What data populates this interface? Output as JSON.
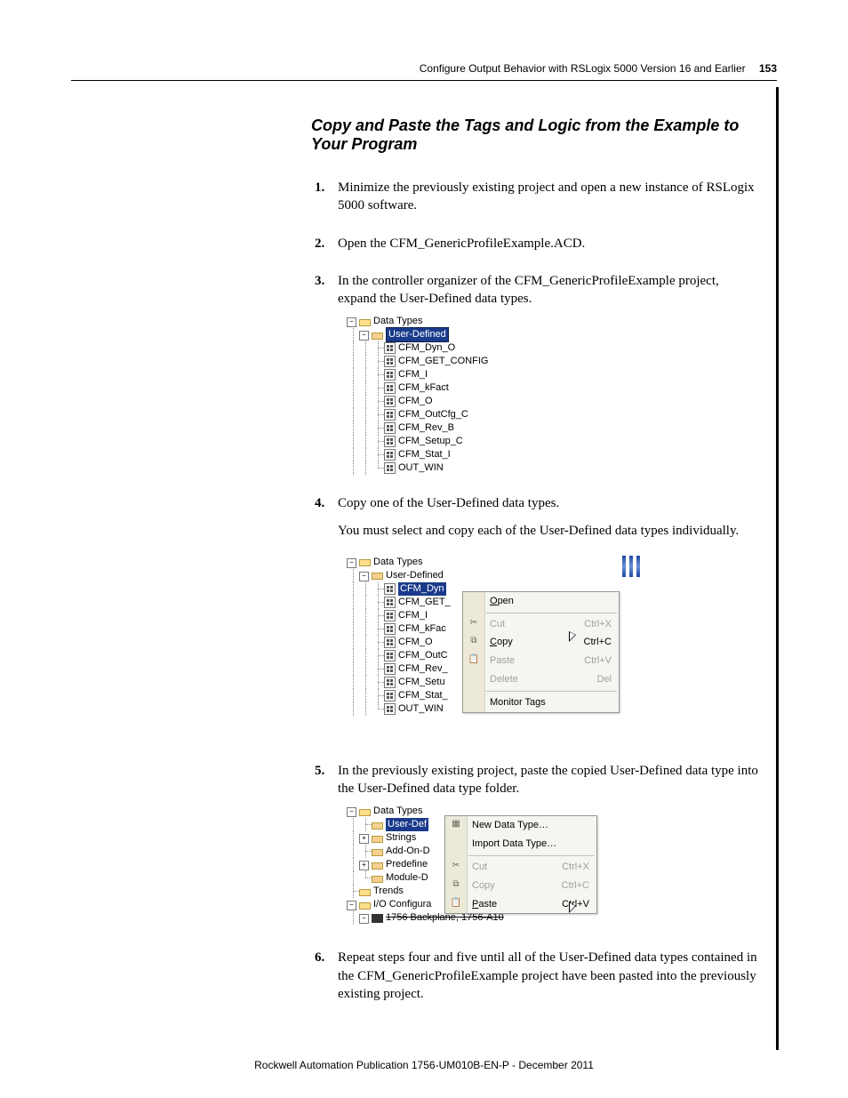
{
  "header": {
    "chapter": "Configure Output Behavior with RSLogix 5000 Version 16 and Earlier",
    "page": "153"
  },
  "section_title": "Copy and Paste the Tags and Logic from the Example to Your Program",
  "steps": {
    "s1": {
      "n": "1.",
      "t": "Minimize the previously existing project and open a new instance of RSLogix 5000 software."
    },
    "s2": {
      "n": "2.",
      "t": "Open the CFM_GenericProfileExample.ACD."
    },
    "s3": {
      "n": "3.",
      "t": "In the controller organizer of the CFM_GenericProfileExample project, expand the User-Defined data types."
    },
    "s4": {
      "n": "4.",
      "t": "Copy one of the User-Defined data types."
    },
    "s4p": "You must select and copy each of the User-Defined data types individually.",
    "s5": {
      "n": "5.",
      "t": "In the previously existing project, paste the copied User-Defined data type into the User-Defined data type folder."
    },
    "s6": {
      "n": "6.",
      "t": "Repeat steps four and five until all of the User-Defined data types contained in the CFM_GenericProfileExample project have been pasted into the previously existing project."
    }
  },
  "fig3": {
    "root": "Data Types",
    "folder": "User-Defined",
    "items": [
      "CFM_Dyn_O",
      "CFM_GET_CONFIG",
      "CFM_I",
      "CFM_kFact",
      "CFM_O",
      "CFM_OutCfg_C",
      "CFM_Rev_B",
      "CFM_Setup_C",
      "CFM_Stat_I",
      "OUT_WIN"
    ]
  },
  "fig4": {
    "root": "Data Types",
    "folder": "User-Defined",
    "sel": "CFM_Dyn",
    "rest": [
      "CFM_GET_",
      "CFM_I",
      "CFM_kFac",
      "CFM_O",
      "CFM_OutC",
      "CFM_Rev_",
      "CFM_Setu",
      "CFM_Stat_",
      "OUT_WIN"
    ],
    "menu": {
      "open": "Open",
      "cut": "Cut",
      "cut_sc": "Ctrl+X",
      "copy": "Copy",
      "copy_sc": "Ctrl+C",
      "paste": "Paste",
      "paste_sc": "Ctrl+V",
      "delete": "Delete",
      "delete_sc": "Del",
      "monitor": "Monitor Tags"
    }
  },
  "fig5": {
    "root": "Data Types",
    "sel": "User-Def",
    "items": [
      "Strings",
      "Add-On-D",
      "Predefine",
      "Module-D"
    ],
    "trends": "Trends",
    "io": "I/O Configura",
    "backplane": "1756 Backplane, 1756-A10",
    "menu": {
      "new": "New Data Type…",
      "import": "Import Data Type…",
      "cut": "Cut",
      "cut_sc": "Ctrl+X",
      "copy": "Copy",
      "copy_sc": "Ctrl+C",
      "paste": "Paste",
      "paste_sc": "Ctrl+V"
    }
  },
  "footer": "Rockwell Automation Publication 1756-UM010B-EN-P - December 2011"
}
